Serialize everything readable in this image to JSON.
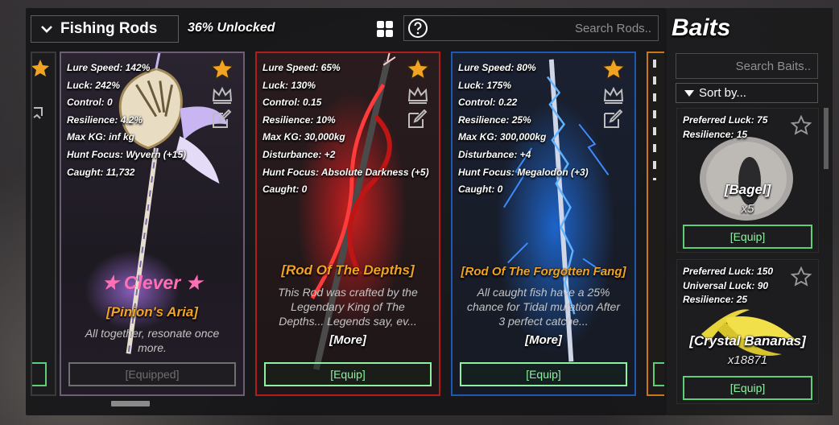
{
  "header": {
    "category_label": "Fishing Rods",
    "unlocked_text": "36% Unlocked",
    "search_placeholder": "Search Rods.."
  },
  "rods": [
    {
      "stats": [
        "Lure Speed: 142%",
        "Luck: 242%",
        "Control: 0",
        "Resilience: 4.2%",
        "Max KG: inf kg",
        "Hunt Focus: Wyvern (+15)",
        "Caught: 11,732"
      ],
      "mutation": "★ Clever ★",
      "name": "[Pinion's Aria]",
      "description": "All together, resonate once more.",
      "button": "[Equipped]",
      "border_color": "#6d5e76"
    },
    {
      "stats": [
        "Lure Speed: 65%",
        "Luck: 130%",
        "Control: 0.15",
        "Resilience: 10%",
        "Max KG: 30,000kg",
        "Disturbance: +2",
        "Hunt Focus: Absolute Darkness (+5)",
        "Caught: 0"
      ],
      "name": "[Rod Of The Depths]",
      "description": "This Rod was crafted by the Legendary King of The Depths... Legends say, ev...",
      "more": "[More]",
      "button": "[Equip]",
      "border_color": "#b01d1d"
    },
    {
      "stats": [
        "Lure Speed: 80%",
        "Luck: 175%",
        "Control: 0.22",
        "Resilience: 25%",
        "Max KG: 300,000kg",
        "Disturbance: +4",
        "Hunt Focus: Megalodon (+3)",
        "Caught: 0"
      ],
      "name": "[Rod Of The Forgotten Fang]",
      "description": "All caught fish have a 25% chance for Tidal mutation After 3 perfect catche...",
      "more": "[More]",
      "button": "[Equip]",
      "border_color": "#1f58b4"
    }
  ],
  "baits_panel": {
    "title": "Baits",
    "search_placeholder": "Search Baits..",
    "sort_label": "Sort by..."
  },
  "baits": [
    {
      "stats": [
        "Preferred Luck: 75",
        "Resilience: 15"
      ],
      "name": "[Bagel]",
      "quantity": "x5",
      "button": "[Equip]"
    },
    {
      "stats": [
        "Preferred Luck: 150",
        "Universal Luck: 90",
        "Resilience: 25"
      ],
      "name": "[Crystal Bananas]",
      "quantity": "x18871",
      "button": "[Equip]"
    }
  ],
  "colors": {
    "rarity_name": "#f2a323",
    "mutation": "#ff6fb3",
    "equip_green": "#5ccf77",
    "star_gold": "#f2a323"
  },
  "icons": [
    "chevron-down-icon",
    "grid-view-icon",
    "help-icon",
    "favorite-star-icon",
    "crown-icon",
    "edit-icon",
    "bait-star-icon"
  ]
}
